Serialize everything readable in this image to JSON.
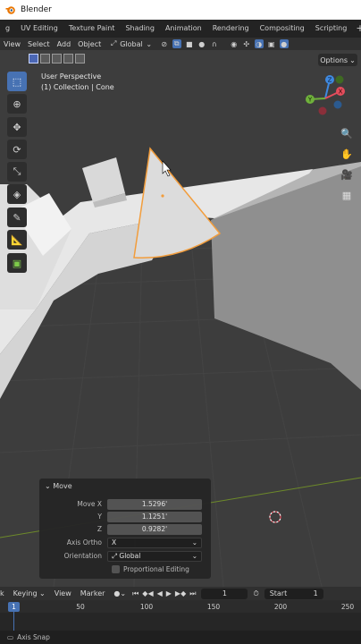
{
  "window": {
    "title": "Blender"
  },
  "workspace_tabs": [
    "g",
    "UV Editing",
    "Texture Paint",
    "Shading",
    "Animation",
    "Rendering",
    "Compositing",
    "Scripting",
    "+"
  ],
  "header": {
    "menus": [
      "View",
      "Select",
      "Add",
      "Object"
    ],
    "transform_orientation": "Global"
  },
  "viewport": {
    "view_name": "User Perspective",
    "collection_label": "(1) Collection | Cone",
    "options_label": "Options",
    "gizmo": {
      "axes": [
        "X",
        "Y",
        "Z"
      ],
      "colors": {
        "x": "#e44d5c",
        "y": "#6fb13b",
        "z": "#3f89e0"
      }
    }
  },
  "tools": [
    "select-box",
    "cursor",
    "move",
    "rotate",
    "scale",
    "transform",
    "annotate",
    "measure",
    "add-cube"
  ],
  "nav_icons": [
    "zoom-icon",
    "hand-pan-icon",
    "camera-icon",
    "grid-icon"
  ],
  "operator_panel": {
    "title": "Move",
    "move_x_label": "Move X",
    "move_x": "1.5296'",
    "y_label": "Y",
    "move_y": "1.1251'",
    "z_label": "Z",
    "move_z": "0.9282'",
    "axis_ortho_label": "Axis Ortho",
    "axis_ortho_value": "X",
    "orientation_label": "Orientation",
    "orientation_value": "Global",
    "proportional_label": "Proportional Editing"
  },
  "timeline": {
    "header_items": [
      "k",
      "Keying",
      "View",
      "Marker"
    ],
    "current_frame": "1",
    "start_label": "Start",
    "start_value": "1",
    "ruler_labels": [
      "1",
      "50",
      "100",
      "150",
      "200",
      "250"
    ],
    "cursor_frame": "1"
  },
  "statusbar": {
    "hint": "Axis Snap"
  },
  "colors": {
    "accent": "#4772b3",
    "selection_outline": "#f29d3c"
  }
}
